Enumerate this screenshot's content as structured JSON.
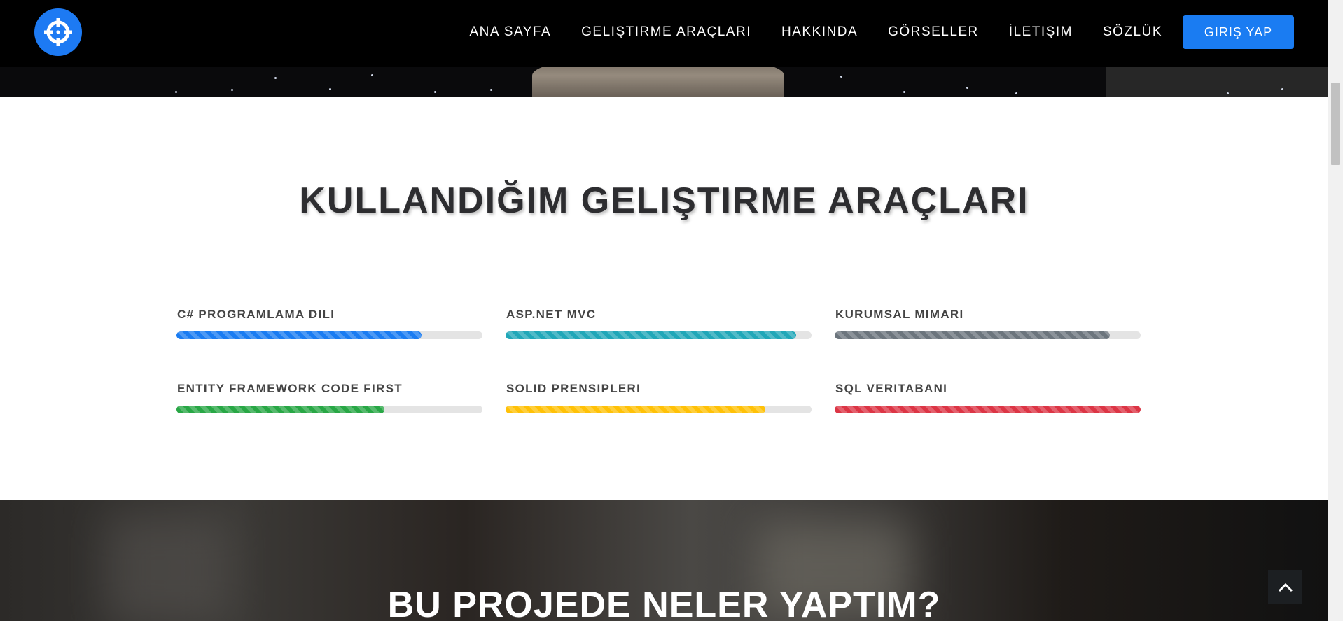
{
  "navbar": {
    "logo_icon": "crosshair-icon",
    "links": [
      "ANA SAYFA",
      "GELIŞTIRME ARAÇLARI",
      "HAKKINDA",
      "GÖRSELLER",
      "İLETIŞIM",
      "SÖZLÜK"
    ],
    "login_label": "GIRIŞ YAP"
  },
  "skills_section": {
    "title": "KULLANDIĞIM GELIŞTIRME ARAÇLARI",
    "skills": [
      {
        "label": "C# PROGRAMLAMA DILI",
        "percent": 80,
        "color": "#1a7cf2"
      },
      {
        "label": "ASP.NET MVC",
        "percent": 95,
        "color": "#20a7b8"
      },
      {
        "label": "KURUMSAL MIMARI",
        "percent": 90,
        "color": "#6c757d"
      },
      {
        "label": "ENTITY FRAMEWORK CODE FIRST",
        "percent": 68,
        "color": "#28a745"
      },
      {
        "label": "SOLID PRENSIPLERI",
        "percent": 85,
        "color": "#ffc107"
      },
      {
        "label": "SQL VERITABANI",
        "percent": 100,
        "color": "#dc3545"
      }
    ]
  },
  "projects_section": {
    "title": "BU PROJEDE NELER YAPTIM?"
  },
  "back_to_top_icon": "chevron-up-icon"
}
